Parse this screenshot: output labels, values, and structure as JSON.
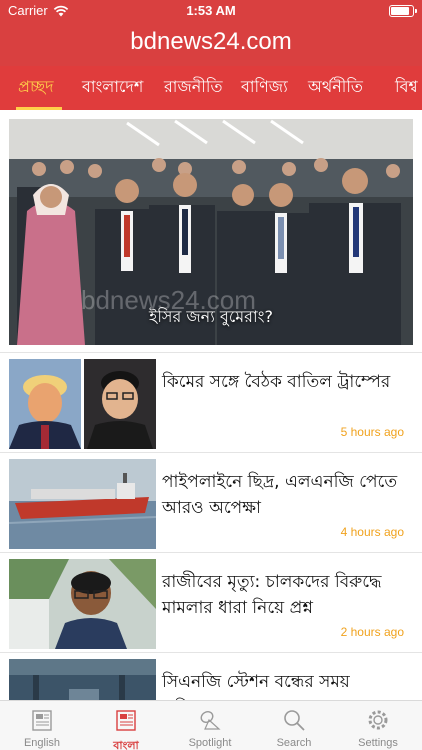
{
  "status_bar": {
    "carrier": "Carrier",
    "time": "1:53 AM",
    "battery_level": 0.9
  },
  "header": {
    "title": "bdnews24.com"
  },
  "tabs": [
    {
      "label": "প্রচ্ছদ",
      "active": true
    },
    {
      "label": "বাংলাদেশ",
      "active": false
    },
    {
      "label": "রাজনীতি",
      "active": false
    },
    {
      "label": "বাণিজ্য",
      "active": false
    },
    {
      "label": "অর্থনীতি",
      "active": false
    },
    {
      "label": "বিশ্ব",
      "active": false
    }
  ],
  "featured": {
    "caption": "ইসির জন্য বুমেরাং?",
    "watermark": "bdnews24.com"
  },
  "articles": [
    {
      "headline": "কিমের সঙ্গে বৈঠক বাতিল ট্রাম্পের",
      "time": "5 hours ago"
    },
    {
      "headline": "পাইপলাইনে ছিদ্র, এলএনজি পেতে আরও অপেক্ষা",
      "time": "4 hours ago"
    },
    {
      "headline": "রাজীবের মৃত্যু: চালকদের বিরুদ্ধে মামলার ধারা নিয়ে প্রশ্ন",
      "time": "2 hours ago"
    },
    {
      "headline": "সিএনজি স্টেশন বন্ধের সময় এগিয়েছে",
      "time": ""
    }
  ],
  "bottom_nav": [
    {
      "label": "English",
      "icon": "newspaper-icon",
      "active": false
    },
    {
      "label": "বাংলা",
      "icon": "newspaper-icon",
      "active": true
    },
    {
      "label": "Spotlight",
      "icon": "spotlight-icon",
      "active": false
    },
    {
      "label": "Search",
      "icon": "search-icon",
      "active": false
    },
    {
      "label": "Settings",
      "icon": "gear-icon",
      "active": false
    }
  ],
  "colors": {
    "brand_red": "#d94040",
    "tab_bar_red": "#e03c3c",
    "active_tab": "#ffd04a",
    "timestamp": "#f0a21e",
    "nav_active": "#d94040",
    "nav_inactive": "#8a8a8a"
  }
}
